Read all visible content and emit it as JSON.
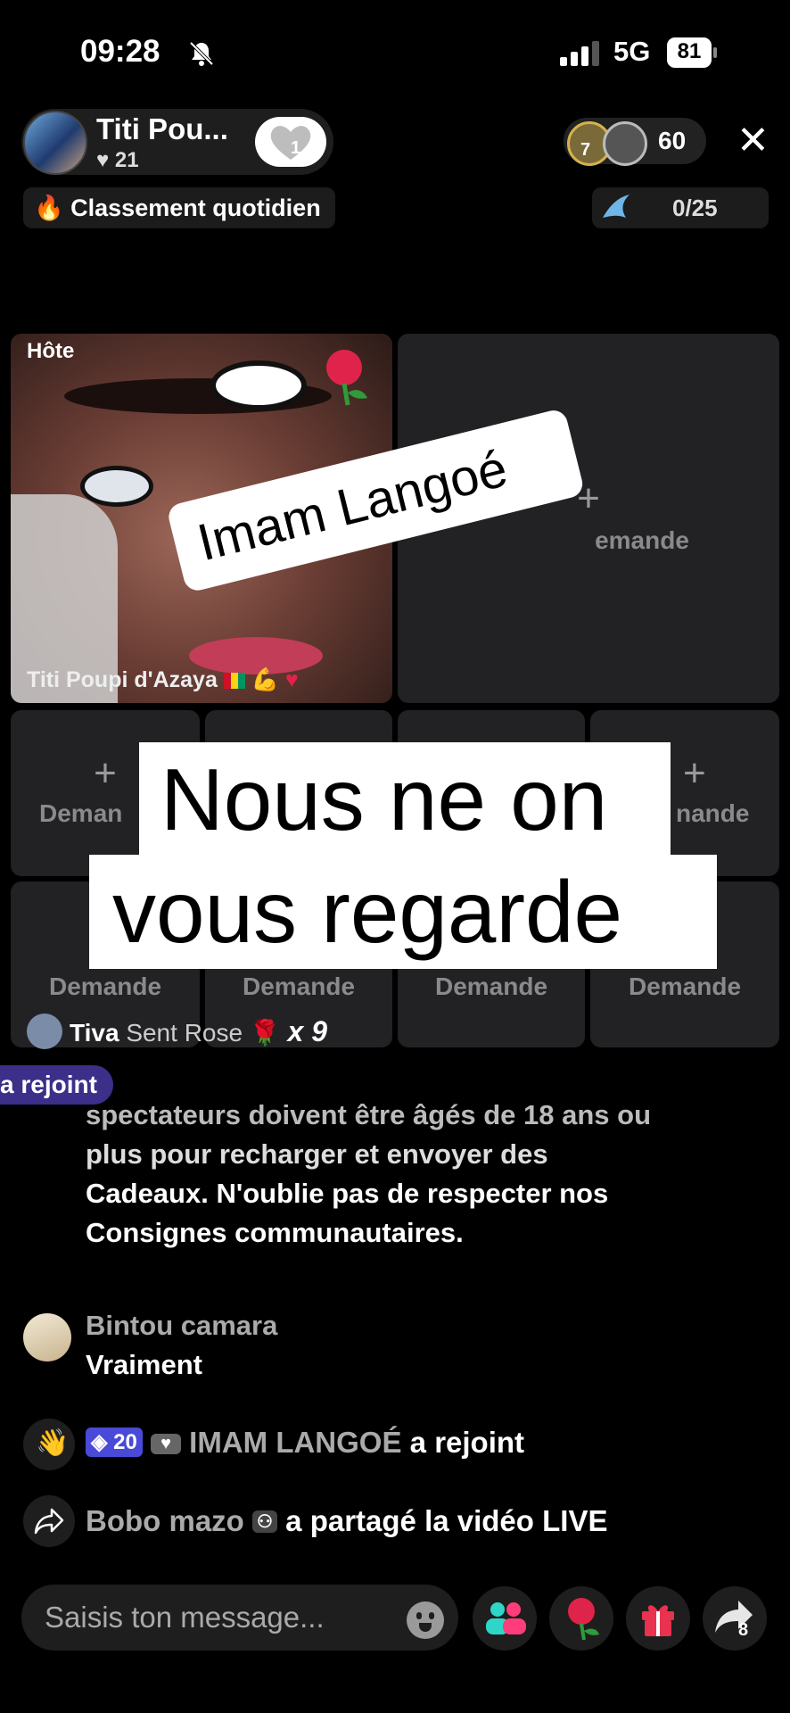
{
  "status_bar": {
    "time": "09:28",
    "network": "5G",
    "battery": "81"
  },
  "host": {
    "name": "Titi Pou...",
    "likes": "21",
    "follow_count": "1"
  },
  "viewers": {
    "count": "60",
    "badge_1": "7"
  },
  "ranking": {
    "label": "Classement quotidien"
  },
  "goal": {
    "progress": "0/25"
  },
  "grid": {
    "host_label": "Hôte",
    "host_tile_name": "Titi Poupi d'Azaya",
    "slot_label": "Demande",
    "slot_label_partial_left": "Deman",
    "slot_label_partial_right": "nande",
    "slot_label_partial_top": "emande"
  },
  "overlays": {
    "tag": "Imam Langoé",
    "caption_line1": "Nous ne on",
    "caption_line2": "vous regarde"
  },
  "gift_notice": {
    "user": "Tiva",
    "action": "Sent Rose",
    "multiplier": "x 9"
  },
  "joined_pill": "a rejoint",
  "system_message": {
    "line1": "spectateurs doivent être âgés de 18 ans ou",
    "line2": "plus pour recharger et envoyer des",
    "line3": "Cadeaux. N'oublie pas de respecter nos",
    "line4": "Consignes communautaires."
  },
  "comments": [
    {
      "user": "Bintou camara",
      "text": "Vraiment"
    }
  ],
  "events": {
    "join": {
      "level": "20",
      "user": "IMAM LANGOÉ",
      "action": "a rejoint"
    },
    "share": {
      "user": "Bobo mazo",
      "action": "a partagé la vidéo LIVE"
    }
  },
  "composer": {
    "placeholder": "Saisis ton message...",
    "share_count": "8"
  },
  "colors": {
    "background": "#000000",
    "level_badge": "#4a4ad8",
    "joined_pill": "#3b2f8a",
    "rose": "#e0234a",
    "gift": "#e8324f",
    "invite": "#2fd6c8"
  }
}
